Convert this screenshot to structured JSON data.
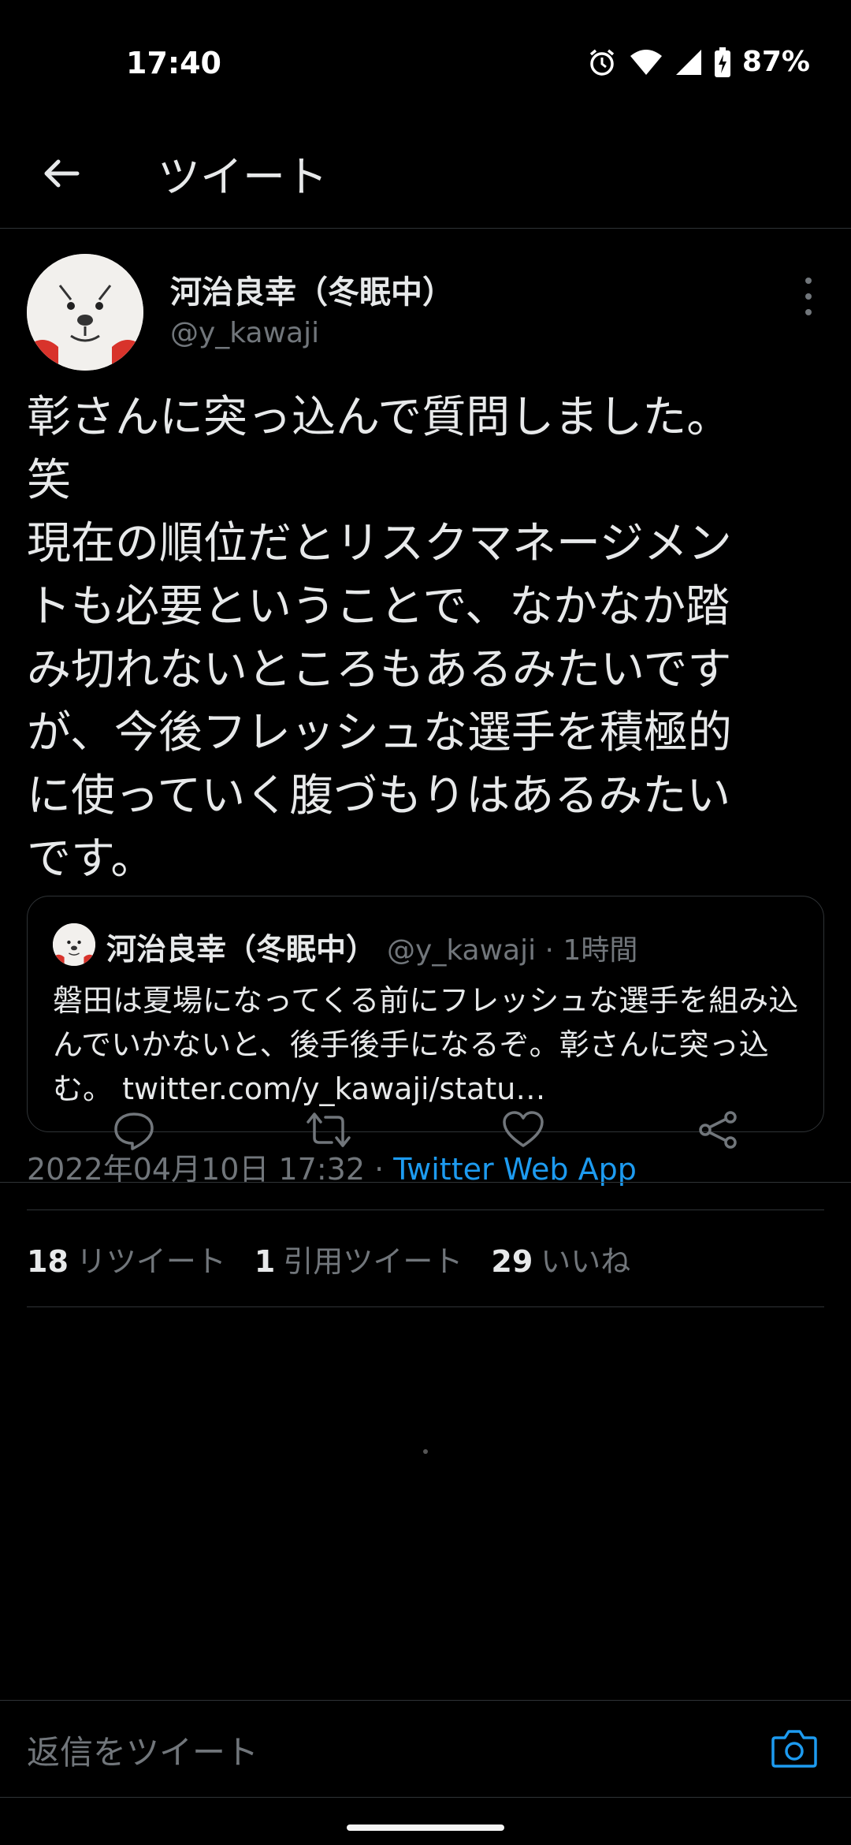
{
  "status_bar": {
    "time": "17:40",
    "battery": "87%",
    "icons": [
      "alarm-icon",
      "wifi-icon",
      "signal-icon",
      "battery-charging-icon"
    ]
  },
  "header": {
    "title": "ツイート",
    "back_icon": "arrow-left-icon"
  },
  "tweet": {
    "author_name": "河治良幸（冬眠中）",
    "author_handle": "@y_kawaji",
    "text": "彰さんに突っ込んで質問しました。\n笑\n現在の順位だとリスクマネージメン\nトも必要ということで、なかなか踏\nみ切れないところもあるみたいです\nが、今後フレッシュな選手を積極的\nに使っていく腹づもりはあるみたい\nです。",
    "quote": {
      "author_name": "河治良幸（冬眠中）",
      "meta": "@y_kawaji · 1時間",
      "text": "磐田は夏場になってくる前にフレッシュな選手を組み込んでいかないと、後手後手になるぞ。彰さんに突っ込む。 twitter.com/y_kawaji/statu…"
    },
    "timestamp": "2022年04月10日 17:32 · ",
    "source": "Twitter Web App",
    "stats": {
      "retweets_count": "18",
      "retweets_label": "リツイート",
      "quotes_count": "1",
      "quotes_label": "引用ツイート",
      "likes_count": "29",
      "likes_label": "いいね"
    }
  },
  "reply_bar": {
    "placeholder": "返信をツイート"
  },
  "colors": {
    "background": "#000000",
    "text": "#e7e9ea",
    "muted": "#71767b",
    "link": "#1d9bf0",
    "divider": "#2f3336"
  }
}
